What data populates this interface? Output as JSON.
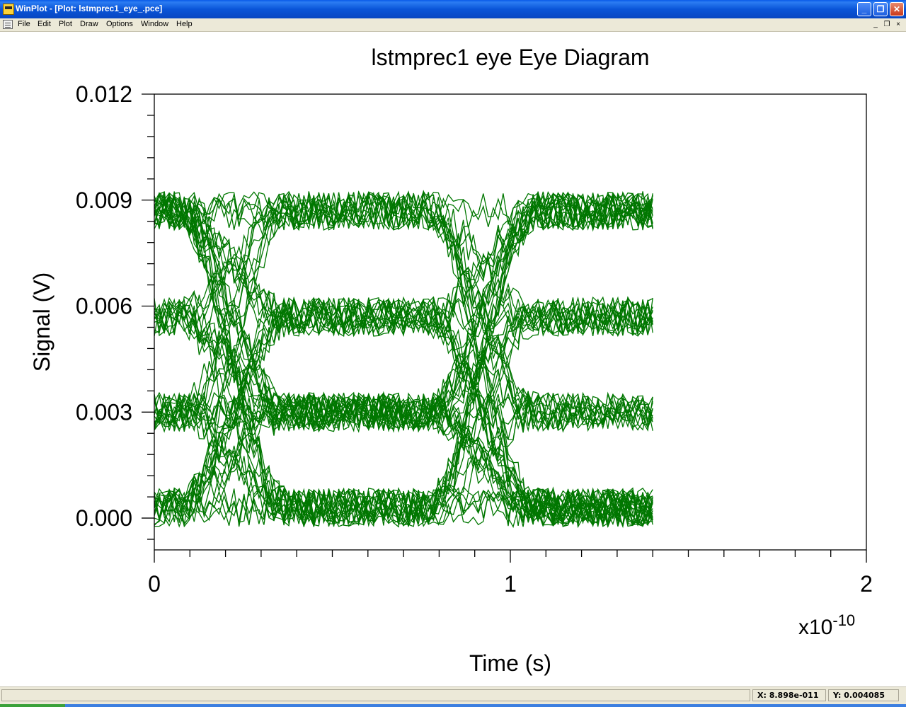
{
  "window": {
    "title": "WinPlot - [Plot: lstmprec1_eye_.pce]",
    "min_glyph": "_",
    "max_glyph": "❐",
    "close_glyph": "✕"
  },
  "menu": {
    "items": [
      "File",
      "Edit",
      "Plot",
      "Draw",
      "Options",
      "Window",
      "Help"
    ],
    "mdi_min": "_",
    "mdi_restore": "❐",
    "mdi_close": "×"
  },
  "status": {
    "x_readout": "X: 8.898e-011",
    "y_readout": "Y: 0.004085"
  },
  "colors": {
    "trace": "#007700",
    "axis": "#000000"
  },
  "chart_data": {
    "type": "line",
    "title": "lstmprec1 eye  Eye Diagram",
    "xlabel": "Time (s)",
    "ylabel": "Signal (V)",
    "x_multiplier_base": "x10",
    "x_multiplier_exp": "-10",
    "xlim": [
      0,
      2
    ],
    "ylim": [
      -0.0009,
      0.012
    ],
    "x_ticks": [
      0,
      1,
      2
    ],
    "x_tick_labels": [
      "0",
      "1",
      "2"
    ],
    "y_ticks": [
      0.0,
      0.003,
      0.006,
      0.009,
      0.012
    ],
    "y_tick_labels": [
      "0.000",
      "0.003",
      "0.006",
      "0.009",
      "0.012"
    ],
    "grid": false,
    "legend": "none",
    "eye": {
      "unit_interval": 0.7,
      "span_end": 1.41,
      "crossing_times": [
        0.22,
        0.92
      ],
      "pam_levels": [
        0.0003,
        0.003,
        0.0057,
        0.0087
      ],
      "noise_pp": 0.0011,
      "trace_count": 70
    }
  }
}
